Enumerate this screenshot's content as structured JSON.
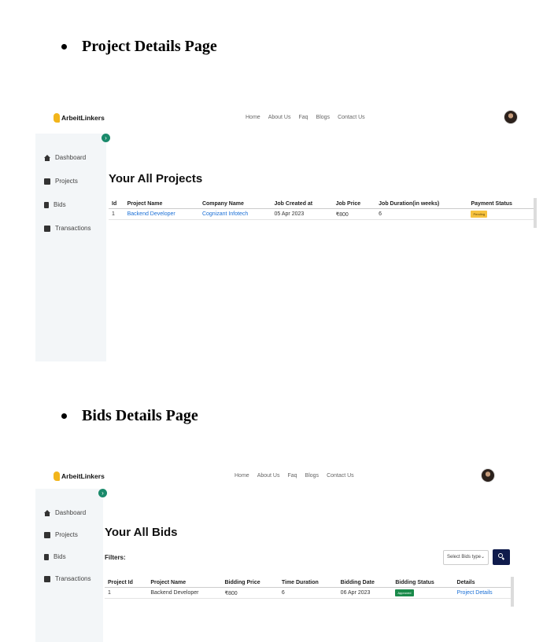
{
  "headings": {
    "project": "Project Details Page",
    "bids": "Bids Details Page"
  },
  "brand": "ArbeitLinkers",
  "nav": [
    "Home",
    "About Us",
    "Faq",
    "Blogs",
    "Contact Us"
  ],
  "sidebar": [
    "Dashboard",
    "Projects",
    "Bids",
    "Transactions"
  ],
  "projects": {
    "title": "Your All Projects",
    "columns": [
      "Id",
      "Project Name",
      "Company Name",
      "Job Created at",
      "Job Price",
      "Job Duration(in weeks)",
      "Payment Status"
    ],
    "rows": [
      {
        "id": "1",
        "project_name": "Backend Developer",
        "company_name": "Cognizant Infotech",
        "created": "05 Apr 2023",
        "price": "₹800",
        "duration": "6",
        "status": "Pending"
      }
    ]
  },
  "bids": {
    "title": "Your All Bids",
    "filters_label": "Filters:",
    "select_placeholder": "Select Bids type",
    "columns": [
      "Project Id",
      "Project Name",
      "Bidding Price",
      "Time Duration",
      "Bidding Date",
      "Bidding Status",
      "Details"
    ],
    "rows": [
      {
        "project_id": "1",
        "project_name": "Backend Developer",
        "price": "₹800",
        "duration": "6",
        "date": "06 Apr 2023",
        "status": "Approved",
        "details": "Project Details"
      }
    ]
  },
  "colors": {
    "accent": "#1a8a6b",
    "link": "#1a6fd6",
    "pending": "#f6c23e",
    "approved": "#1a8a4a",
    "search_button": "#0f1b4c",
    "logo": "#f2b51b"
  }
}
